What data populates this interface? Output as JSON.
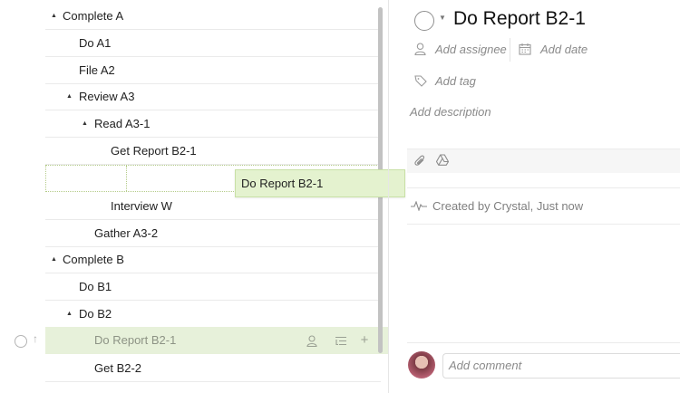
{
  "tree": {
    "rows": [
      {
        "label": "Complete A",
        "has_toggle": true
      },
      {
        "label": "Do A1",
        "has_toggle": false
      },
      {
        "label": "File A2",
        "has_toggle": false
      },
      {
        "label": "Review A3",
        "has_toggle": true
      },
      {
        "label": "Read A3-1",
        "has_toggle": true
      },
      {
        "label": "Get Report B2-1",
        "has_toggle": false
      },
      {
        "label": "Interview W",
        "has_toggle": false
      },
      {
        "label": "Gather A3-2",
        "has_toggle": false
      },
      {
        "label": "Complete B",
        "has_toggle": true
      },
      {
        "label": "Do B1",
        "has_toggle": false
      },
      {
        "label": "Do B2",
        "has_toggle": true
      },
      {
        "label": "Do Report B2-1",
        "has_toggle": false,
        "selected": true
      },
      {
        "label": "Get B2-2",
        "has_toggle": false
      }
    ],
    "drag_label": "Do Report B2-1",
    "toggle_glyph": "▲"
  },
  "detail": {
    "title": "Do Report B2-1",
    "assignee": "Add assignee",
    "date": "Add date",
    "tag": "Add tag",
    "description": "Add description",
    "activity": "Created by Crystal, Just now",
    "comment_placeholder": "Add comment"
  },
  "colors": {
    "selected_bg": "#e7f1da",
    "drag_bg": "#e4f2cf"
  }
}
